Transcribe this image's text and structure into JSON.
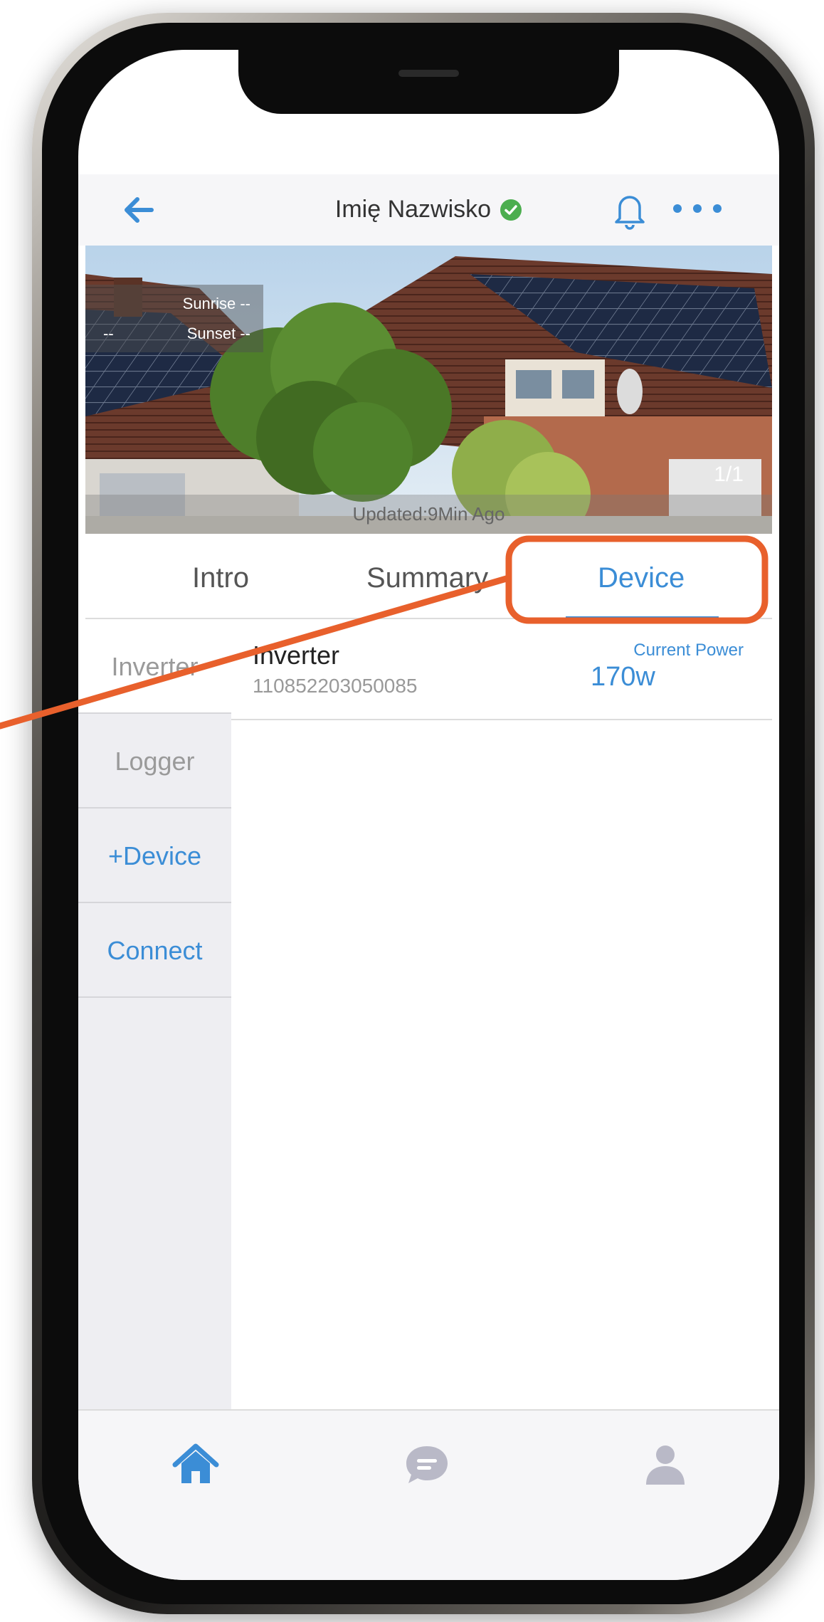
{
  "header": {
    "title": "Imię Nazwisko",
    "verified_icon": "check-circle-icon",
    "back_icon": "arrow-left-icon",
    "bell_icon": "bell-icon",
    "more_icon": "more-horizontal-icon"
  },
  "banner": {
    "sunrise": "Sunrise --",
    "sunset": "Sunset --",
    "sunset_prefix": "--",
    "updated": "Updated:9Min Ago",
    "page_counter": "1/1"
  },
  "tabs": [
    {
      "label": "Intro"
    },
    {
      "label": "Summary"
    },
    {
      "label": "Device",
      "active": true
    }
  ],
  "side_menu": [
    {
      "label": "Inverter",
      "active": true
    },
    {
      "label": "Logger"
    },
    {
      "label": "+Device"
    },
    {
      "label": "Connect"
    }
  ],
  "devices": [
    {
      "name": "Inverter",
      "serial": "110852203050085",
      "power_label": "Current Power",
      "power_value": "170w"
    }
  ],
  "bottom_nav": {
    "home_icon": "home-icon",
    "chat_icon": "chat-bubble-icon",
    "user_icon": "user-icon"
  },
  "colors": {
    "accent": "#3b8dd6",
    "annotation": "#e8602c",
    "verified": "#4cae4f"
  }
}
